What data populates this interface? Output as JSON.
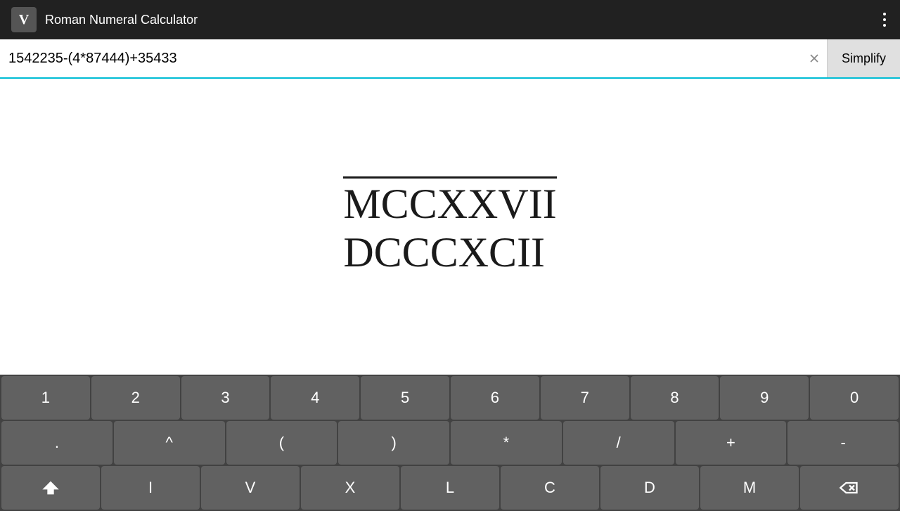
{
  "titleBar": {
    "logo": "V",
    "title": "Roman Numeral Calculator",
    "menuIcon": "dots-vertical-icon"
  },
  "inputBar": {
    "expression": "1542235-(4*87444)+35433",
    "clearIcon": "clear-icon",
    "simplifyLabel": "Simplify"
  },
  "result": {
    "overlinePart": "MCCXXVII",
    "normalPart": "DCCCXCII"
  },
  "keyboard": {
    "numberRow": [
      "1",
      "2",
      "3",
      "4",
      "5",
      "6",
      "7",
      "8",
      "9",
      "0"
    ],
    "symbolRow": [
      ".",
      "^",
      "(",
      ")",
      "*",
      "/",
      "+",
      "-"
    ],
    "romanRow": [
      "⇧",
      "I",
      "V",
      "X",
      "L",
      "C",
      "D",
      "M",
      "⌫"
    ]
  }
}
